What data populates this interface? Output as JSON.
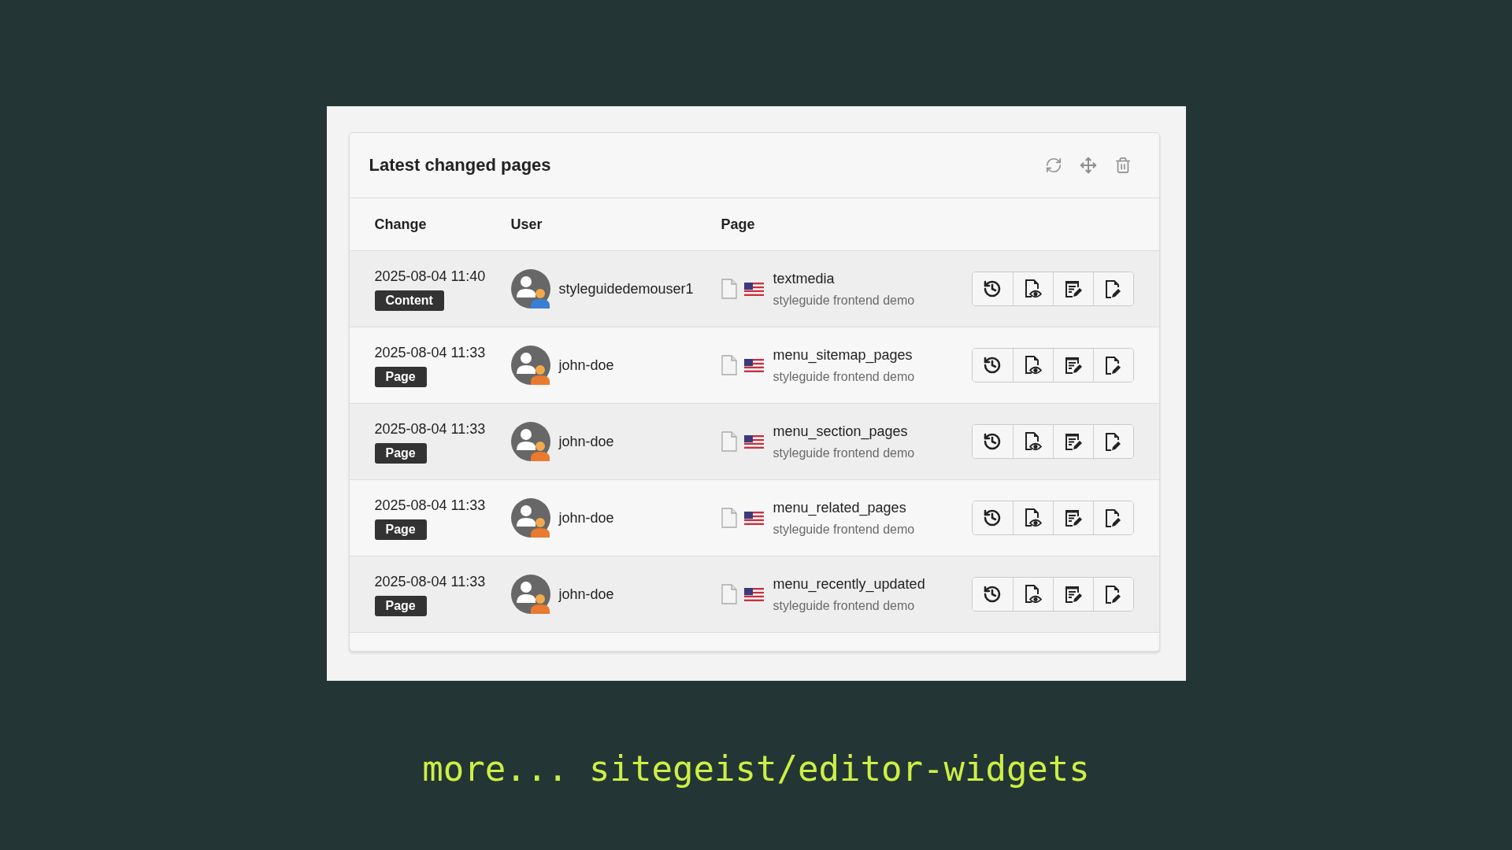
{
  "widget": {
    "title": "Latest changed pages"
  },
  "columns": [
    "Change",
    "User",
    "Page"
  ],
  "rows": [
    {
      "changed": "2025-08-04 11:40",
      "type": "Content",
      "user": {
        "name": "styleguidedemouser1",
        "color": "#3b7fd4"
      },
      "page": {
        "title": "textmedia",
        "site": "styleguide frontend demo"
      }
    },
    {
      "changed": "2025-08-04 11:33",
      "type": "Page",
      "user": {
        "name": "john-doe",
        "color": "#ea7a2f"
      },
      "page": {
        "title": "menu_sitemap_pages",
        "site": "styleguide frontend demo"
      }
    },
    {
      "changed": "2025-08-04 11:33",
      "type": "Page",
      "user": {
        "name": "john-doe",
        "color": "#ea7a2f"
      },
      "page": {
        "title": "menu_section_pages",
        "site": "styleguide frontend demo"
      }
    },
    {
      "changed": "2025-08-04 11:33",
      "type": "Page",
      "user": {
        "name": "john-doe",
        "color": "#ea7a2f"
      },
      "page": {
        "title": "menu_related_pages",
        "site": "styleguide frontend demo"
      }
    },
    {
      "changed": "2025-08-04 11:33",
      "type": "Page",
      "user": {
        "name": "john-doe",
        "color": "#ea7a2f"
      },
      "page": {
        "title": "menu_recently_updated",
        "site": "styleguide frontend demo"
      }
    }
  ],
  "caption": "more... sitegeist/editor-widgets"
}
